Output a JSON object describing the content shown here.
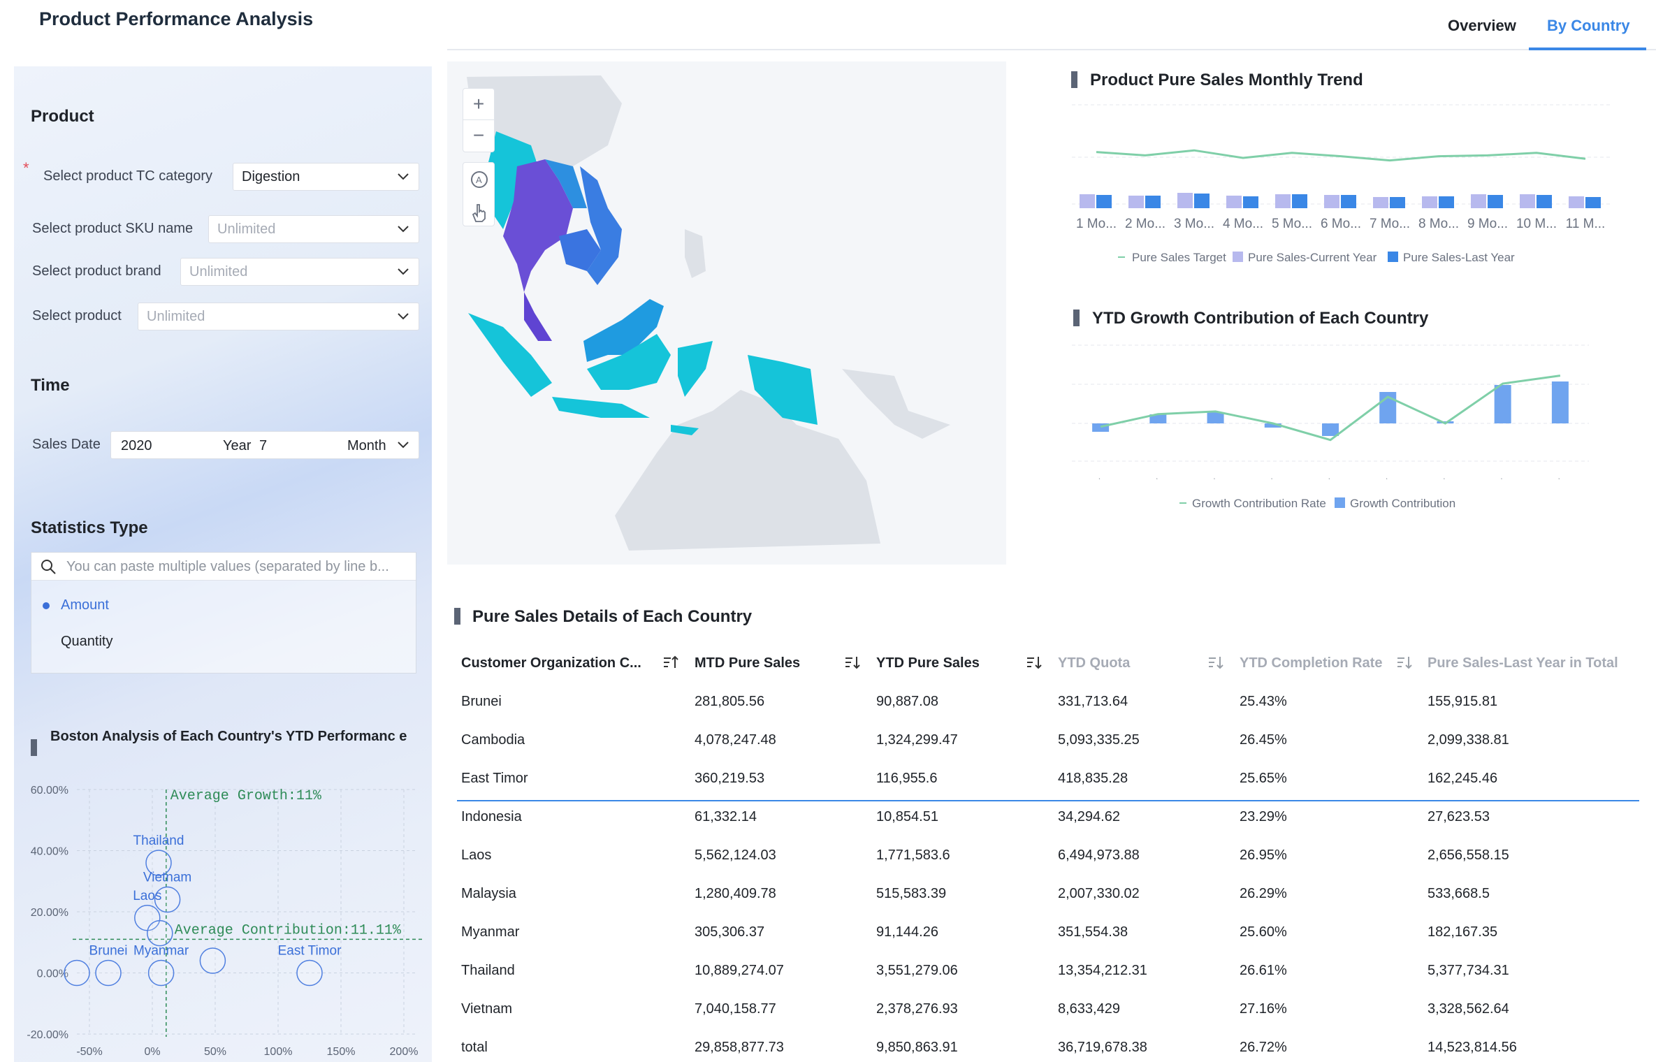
{
  "header": {
    "title": "Product Performance Analysis",
    "tabs": [
      {
        "label": "Overview",
        "active": false
      },
      {
        "label": "By Country",
        "active": true
      }
    ],
    "accent_color": "#3a87e6"
  },
  "filters": {
    "product_section": "Product",
    "fields": [
      {
        "label": "Select product TC category",
        "value": "Digestion",
        "required": true
      },
      {
        "label": "Select product SKU name",
        "value": "Unlimited"
      },
      {
        "label": "Select product brand",
        "value": "Unlimited"
      },
      {
        "label": "Select product",
        "value": "Unlimited"
      }
    ],
    "time_section": "Time",
    "sales_date_label": "Sales Date",
    "date_year": "2020",
    "date_year_unit": "Year",
    "date_month": "7",
    "date_month_unit": "Month",
    "stats_section": "Statistics Type",
    "search_placeholder": "You can paste multiple values (separated by line b...",
    "options": [
      {
        "label": "Amount",
        "selected": true
      },
      {
        "label": "Quantity",
        "selected": false
      }
    ]
  },
  "boston": {
    "title": "Boston Analysis of Each Country's YTD Performanc e",
    "avg_growth_label": "Average Growth:11%",
    "avg_contrib_label": "Average Contribution:11.11%",
    "y_ticks": [
      "60.00%",
      "40.00%",
      "20.00%",
      "0.00%",
      "-20.00%"
    ],
    "x_ticks": [
      "-50%",
      "0%",
      "50%",
      "100%",
      "150%",
      "200%"
    ],
    "points": [
      {
        "label": "Thailand",
        "x": 5,
        "y": 36
      },
      {
        "label": "Vietnam",
        "x": 12,
        "y": 24
      },
      {
        "label": "Laos",
        "x": -4,
        "y": 18
      },
      {
        "label": "",
        "x": 6,
        "y": 13
      },
      {
        "label": "Brunei",
        "x": -35,
        "y": 0
      },
      {
        "label": "Myanmar",
        "x": 7,
        "y": 0
      },
      {
        "label": "",
        "x": 48,
        "y": 4
      },
      {
        "label": "East Timor",
        "x": 125,
        "y": 0
      },
      {
        "label": "",
        "x": -60,
        "y": 0
      }
    ]
  },
  "monthly": {
    "title": "Product Pure Sales Monthly Trend",
    "months": [
      "1 Mo...",
      "2 Mo...",
      "3 Mo...",
      "4 Mo...",
      "5 Mo...",
      "6 Mo...",
      "7 Mo...",
      "8 Mo...",
      "9 Mo...",
      "10 M...",
      "11 M..."
    ],
    "target": [
      62,
      58,
      64,
      55,
      61,
      57,
      52,
      57,
      58,
      61,
      54
    ],
    "current": [
      20,
      18,
      22,
      18,
      20,
      19,
      16,
      17,
      20,
      20,
      17
    ],
    "last_year": [
      19,
      18,
      21,
      17,
      20,
      19,
      16,
      17,
      19,
      19,
      16
    ],
    "legend": [
      "Pure Sales Target",
      "Pure Sales-Current Year",
      "Pure Sales-Last Year"
    ],
    "colors": {
      "target": "#7fcfa8",
      "current": "#b7b9ee",
      "last_year": "#3a87e6"
    }
  },
  "ytd_growth": {
    "title": "YTD Growth Contribution of Each Country",
    "legend": [
      "Growth Contribution Rate",
      "Growth Contribution"
    ],
    "bars": [
      -12,
      13,
      16,
      -6,
      -18,
      45,
      3,
      55,
      60
    ],
    "line": [
      -5,
      14,
      18,
      0,
      -25,
      40,
      0,
      60,
      72
    ],
    "colors": {
      "line": "#7fcfa8",
      "bar": "#6fa4ef"
    }
  },
  "table": {
    "title": "Pure Sales Details of Each Country",
    "columns": [
      "Customer Organization C...",
      "MTD Pure Sales",
      "YTD Pure Sales",
      "YTD Quota",
      "YTD Completion Rate",
      "Pure Sales-Last Year in Total"
    ],
    "rows": [
      [
        "Brunei",
        "281,805.56",
        "90,887.08",
        "331,713.64",
        "25.43%",
        "155,915.81"
      ],
      [
        "Cambodia",
        "4,078,247.48",
        "1,324,299.47",
        "5,093,335.25",
        "26.45%",
        "2,099,338.81"
      ],
      [
        "East Timor",
        "360,219.53",
        "116,955.6",
        "418,835.28",
        "25.65%",
        "162,245.46"
      ],
      [
        "Indonesia",
        "61,332.14",
        "10,854.51",
        "34,294.62",
        "23.29%",
        "27,623.53"
      ],
      [
        "Laos",
        "5,562,124.03",
        "1,771,583.6",
        "6,494,973.88",
        "26.95%",
        "2,656,558.15"
      ],
      [
        "Malaysia",
        "1,280,409.78",
        "515,583.39",
        "2,007,330.02",
        "26.29%",
        "533,668.5"
      ],
      [
        "Myanmar",
        "305,306.37",
        "91,144.26",
        "351,554.38",
        "25.60%",
        "182,167.35"
      ],
      [
        "Thailand",
        "10,889,274.07",
        "3,551,279.06",
        "13,354,212.31",
        "26.61%",
        "5,377,734.31"
      ],
      [
        "Vietnam",
        "7,040,158.77",
        "2,378,276.93",
        "8,633,429",
        "27.16%",
        "3,328,562.64"
      ],
      [
        "total",
        "29,858,877.73",
        "9,850,863.91",
        "36,719,678.38",
        "26.72%",
        "14,523,814.56"
      ]
    ]
  }
}
